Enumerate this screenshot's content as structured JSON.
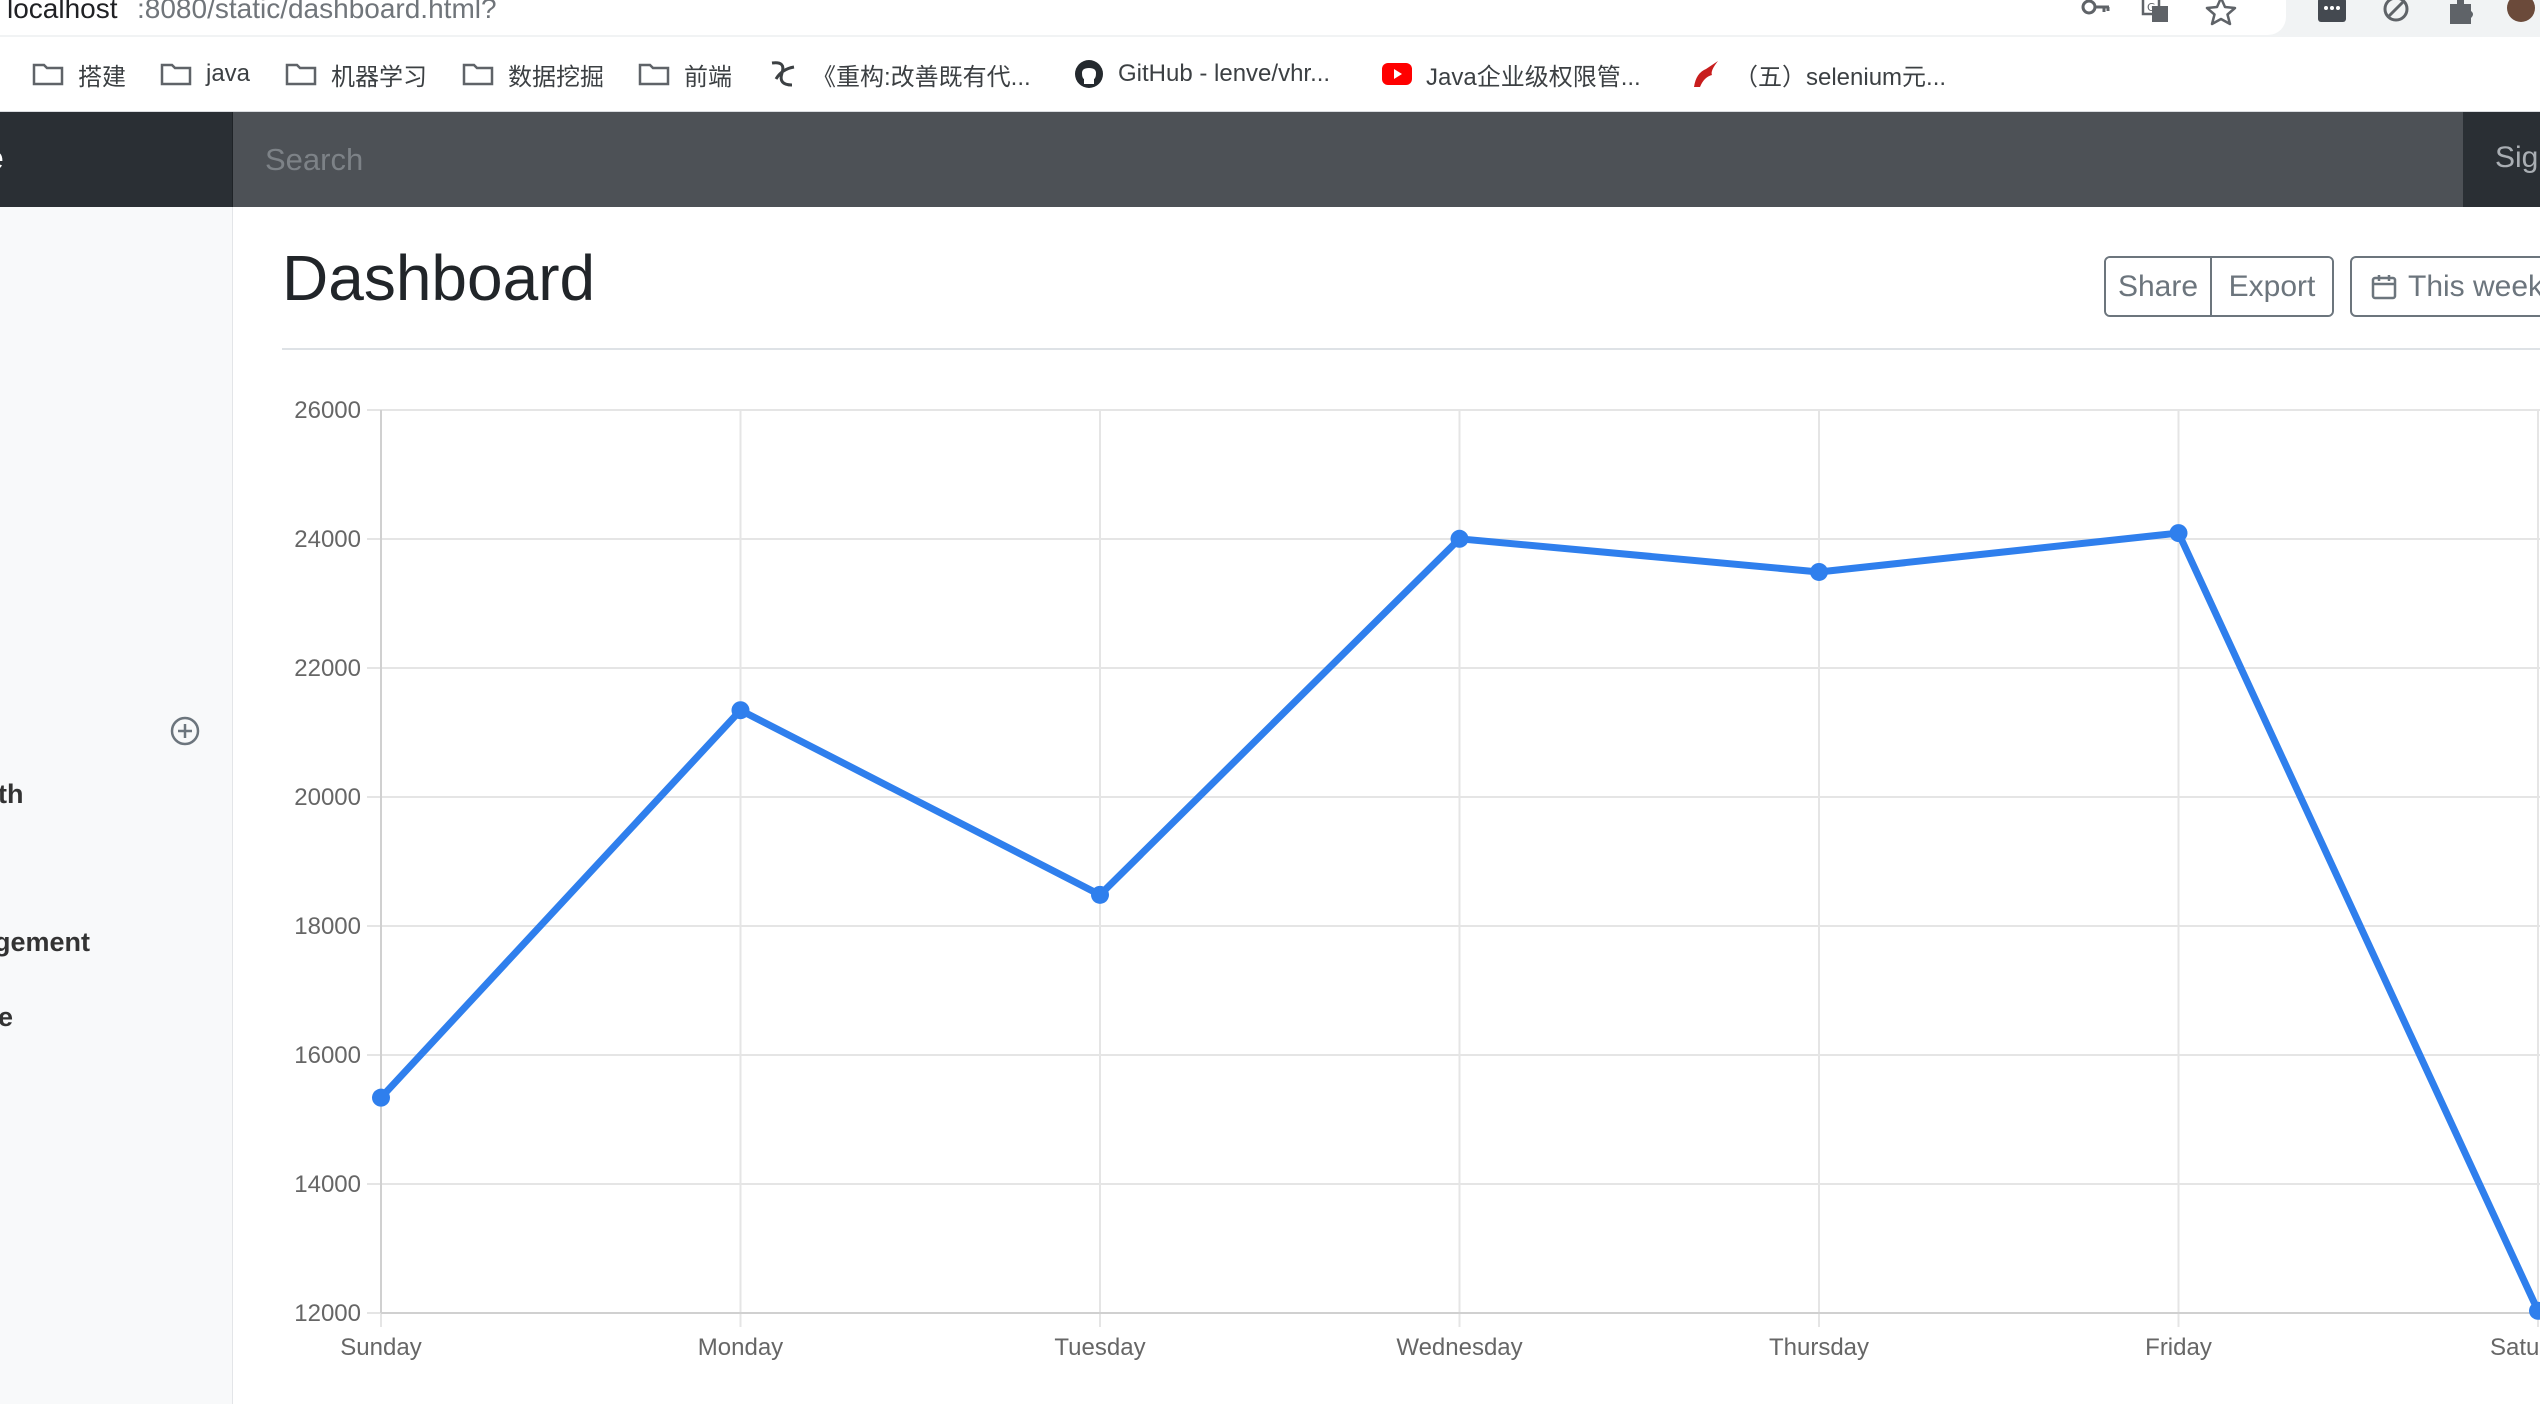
{
  "browser": {
    "url_host": "localhost",
    "url_path": ":8080/static/dashboard.html?",
    "bookmarks": [
      {
        "label": "搭建",
        "icon": "folder-icon"
      },
      {
        "label": "java",
        "icon": "folder-icon"
      },
      {
        "label": "机器学习",
        "icon": "folder-icon"
      },
      {
        "label": "数据挖掘",
        "icon": "folder-icon"
      },
      {
        "label": "前端",
        "icon": "folder-icon"
      },
      {
        "label": "《重构:改善既有代...",
        "icon": "site-icon"
      },
      {
        "label": "GitHub - lenve/vhr...",
        "icon": "github-icon"
      },
      {
        "label": "Java企业级权限管...",
        "icon": "youtube-icon"
      },
      {
        "label": "（五）selenium元...",
        "icon": "site-icon"
      }
    ]
  },
  "navbar": {
    "brand": "e",
    "search_placeholder": "Search",
    "signout": "Sign out"
  },
  "sidebar": {
    "items": [
      "th",
      "gement",
      "e"
    ]
  },
  "main": {
    "title": "Dashboard",
    "share": "Share",
    "export": "Export",
    "range": "This week"
  },
  "colors": {
    "line": "#2f7fed",
    "navbar": "#343a40",
    "sidebar": "#f8f9fa"
  },
  "chart_data": {
    "type": "line",
    "categories": [
      "Sunday",
      "Monday",
      "Tuesday",
      "Wednesday",
      "Thursday",
      "Friday",
      "Saturday"
    ],
    "series": [
      {
        "values": [
          15339,
          21345,
          18483,
          24003,
          23489,
          24092,
          12034
        ]
      }
    ],
    "yticks": [
      12000,
      14000,
      16000,
      18000,
      20000,
      22000,
      24000,
      26000
    ],
    "ylim": [
      12000,
      26000
    ],
    "grid": true,
    "legend": "none"
  }
}
